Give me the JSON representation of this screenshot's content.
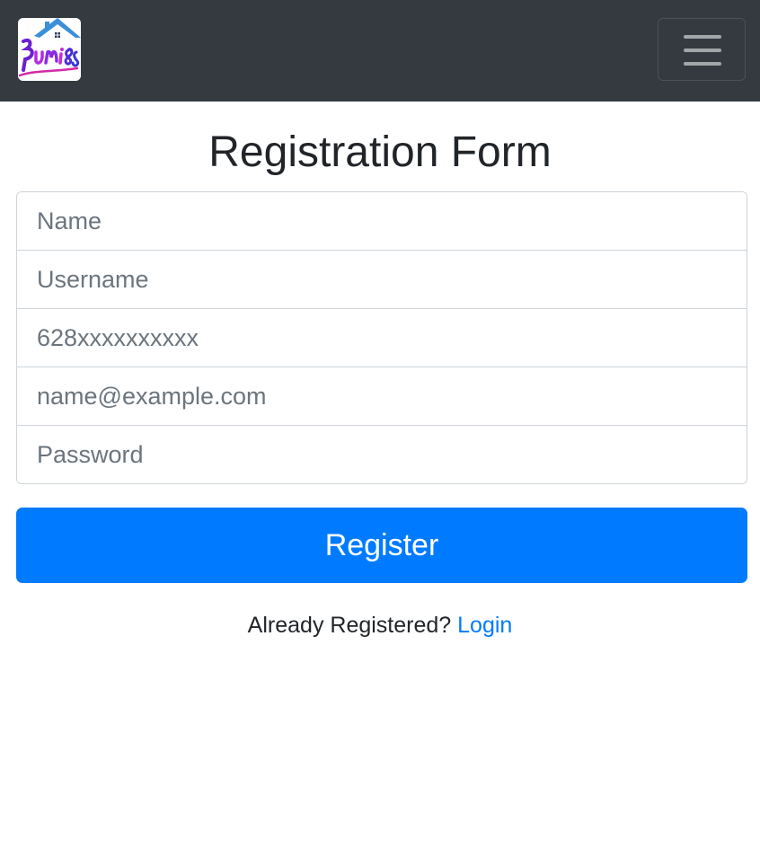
{
  "navbar": {
    "brand_logo_text": "Bumi88",
    "toggler_icon": "hamburger-menu-icon",
    "background": "#343a40"
  },
  "page": {
    "title": "Registration Form"
  },
  "form": {
    "name_placeholder": "Name",
    "username_placeholder": "Username",
    "phone_placeholder": "628xxxxxxxxxx",
    "email_placeholder": "name@example.com",
    "password_placeholder": "Password",
    "submit_label": "Register",
    "submit_color": "#007bff"
  },
  "footer": {
    "already_text": "Already Registered?",
    "login_label": "Login",
    "link_color": "#007bff"
  }
}
